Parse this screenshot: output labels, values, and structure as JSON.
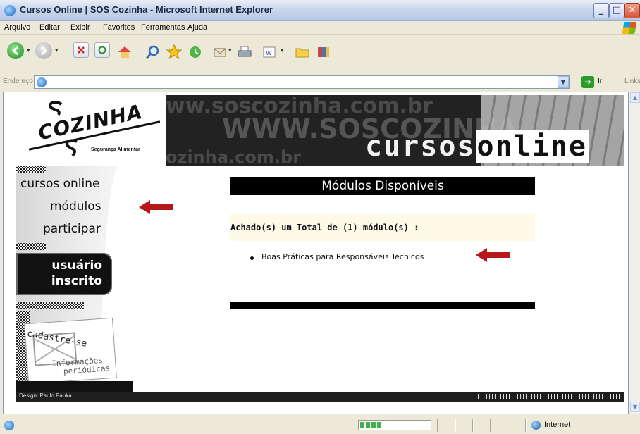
{
  "window": {
    "title": "Cursos Online | SOS Cozinha - Microsoft Internet Explorer"
  },
  "menu": {
    "items": [
      "Arquivo",
      "Editar",
      "Exibir",
      "Favoritos",
      "Ferramentas",
      "Ajuda"
    ]
  },
  "address_bar": {
    "label": "Endereço",
    "go_label": "Ir",
    "links_label": "Links"
  },
  "header": {
    "logo_main": "COZINHA",
    "logo_tagline": "Segurança Alimentar",
    "bg_url_1": "ww.soscozinha.com.br",
    "bg_url_2": "WWW.SOSCOZINHA",
    "bg_url_3": "ozinha.com.br",
    "title_part1": "cursos",
    "title_part2": "online"
  },
  "nav": {
    "item1": "cursos online",
    "item2": "módulos",
    "item3": "participar",
    "inscrito_line1": "usuário",
    "inscrito_line2": "inscrito",
    "cadastre_title": "cadastre-se",
    "cadastre_sub1": "Informações",
    "cadastre_sub2": "periódicas"
  },
  "main": {
    "title": "Módulos Disponíveis",
    "result_text": "Achado(s) um Total de (1) módulo(s) :",
    "modules": [
      "Boas Práticas para Responsáveis Técnicos"
    ]
  },
  "footer": {
    "credit": "Design: Paulo Pauka"
  },
  "status": {
    "zone": "Internet",
    "progress": 0.3
  },
  "colors": {
    "arrow": "#b41818",
    "title_bar": "#c9d6ec",
    "nav_dark": "#111111"
  }
}
